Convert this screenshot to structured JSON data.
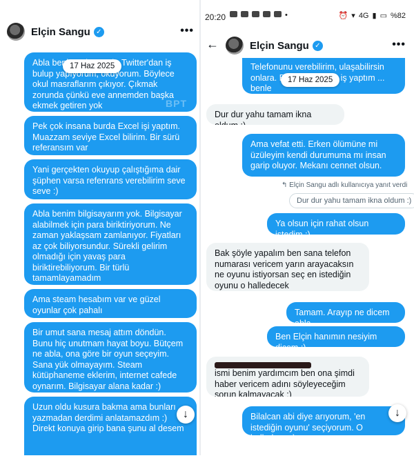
{
  "left": {
    "contact_name": "Elçin Sangu",
    "date_chip": "17 Haz 2025",
    "watermark": "BPT",
    "messages": [
      "Abla benim adım ... dır Twitter'dan iş bulup yapıyorum, okuyorum. Böylece okul masraflarım çıkıyor. Çıkmak zorunda çünkü eve annemden başka ekmek getiren yok",
      "Pek çok insana burda Excel işi yaptım. Muazzam seviye Excel bilirim. Bir sürü referansım var",
      "Yani gerçekten okuyup çalıştığıma dair şüphen varsa refenrans verebilirim seve seve :)",
      "Abla benim bilgisayarım yok. Bilgisayar alabilmek için para biriktiriyorum. Ne zaman yaklaşsam zamlanıyor. Fiyatları az çok biliyorsundur. Sürekli gelirim olmadığı için yavaş para biriktirebiliyorum. Bir türlü tamamlayamadım",
      "Ama steam hesabım var ve güzel oyunlar çok pahalı",
      "Bir umut sana mesaj attım döndün. Bunu hiç unutmam hayat boyu. Bütçem ne abla, ona göre bir oyun seçeyim. Sana yük olmayayım. Steam kütüphaneme eklerim, internet cafede oynarım. Bilgisayar alana kadar :)",
      "Uzun oldu kusura bakma ama bunları yazmadan derdimi anlatamazdım :) Direkt konuya girip bana şunu al desem"
    ]
  },
  "right": {
    "status_time": "20:20",
    "status_battery": "%82",
    "status_network": "4G",
    "contact_name": "Elçin Sangu",
    "date_chip": "17 Haz 2025",
    "messages": [
      {
        "side": "sent",
        "text": "Telefonunu verebilirim, ulaşabilirsin onlara. B... olurlar. Çok iş yaptım ... benle"
      },
      {
        "side": "recv",
        "text": "Dur dur yahu tamam ikna oldum :)"
      },
      {
        "side": "sent",
        "text": "Ama vefat etti. Erken ölümüne mi üzüleyim kendi durumuma mı insan garip oluyor. Mekanı cennet olsun."
      },
      {
        "side": "sent",
        "text": "Ya olsun için rahat olsun istedim :)"
      },
      {
        "side": "recv",
        "text": "Bak şöyle yapalım ben sana telefon numarası vericem yarın arayacaksın ne oyunu istiyorsan seç en istediğin oyunu o halledecek"
      },
      {
        "side": "sent",
        "text": "Tamam. Arayıp ne dicem abla"
      },
      {
        "side": "sent",
        "text": "Ben Elçin hanımın nesiyim dicem :)"
      },
      {
        "side": "recv",
        "text_after_redaction": "ismi benim yardımcım ben ona şimdi haber vericem adını söyleyeceğim sorun kalmayacak :)"
      },
      {
        "side": "sent",
        "text": "Bilalcan abi diye arıyorum, 'en istediğin oyunu' seçiyorum. O halledıyor :)"
      }
    ],
    "reply_note": "Elçin Sangu adlı kullanıcıya yanıt verdi",
    "quoted_text": "Dur dur yahu tamam ikna oldum :)"
  }
}
